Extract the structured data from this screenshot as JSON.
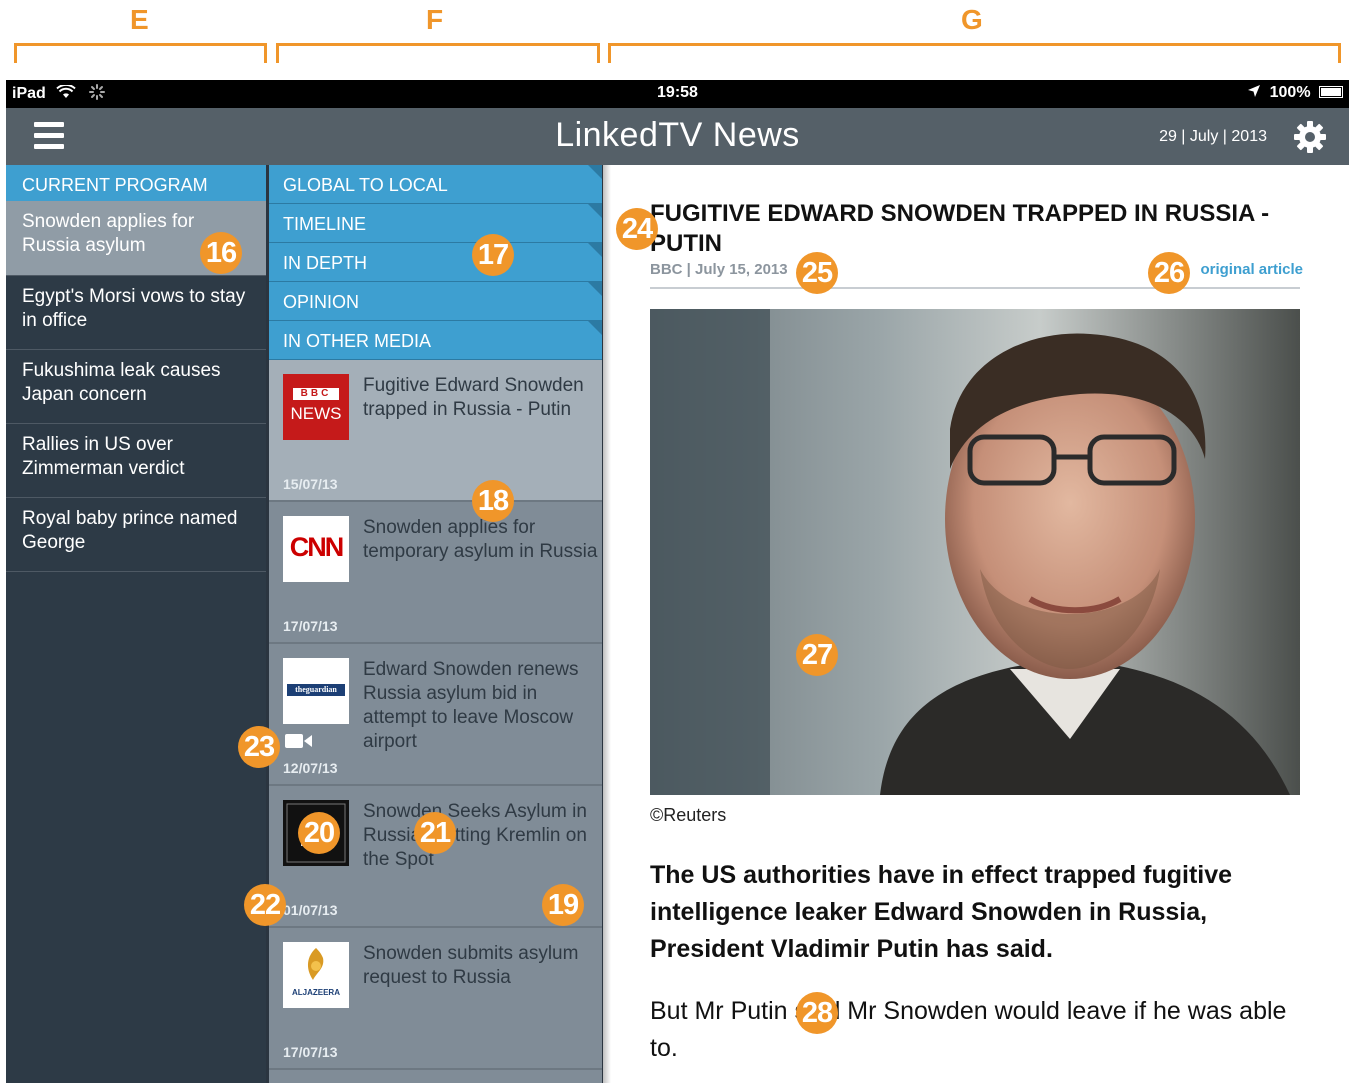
{
  "sections": [
    {
      "letter": "E"
    },
    {
      "letter": "F"
    },
    {
      "letter": "G"
    }
  ],
  "status_bar": {
    "device": "iPad",
    "time": "19:58",
    "battery": "100%"
  },
  "app_bar": {
    "title": "LinkedTV News",
    "date": "29 | July | 2013"
  },
  "program_list": {
    "header": "CURRENT PROGRAM",
    "items": [
      {
        "label": "Snowden applies for Russia asylum",
        "active": true
      },
      {
        "label": "Egypt's Morsi vows to stay in office",
        "active": false
      },
      {
        "label": "Fukushima leak causes Japan concern",
        "active": false
      },
      {
        "label": "Rallies in US over Zimmerman verdict",
        "active": false
      },
      {
        "label": "Royal baby prince named George",
        "active": false
      }
    ]
  },
  "topic_tabs": [
    "GLOBAL TO LOCAL",
    "TIMELINE",
    "IN DEPTH",
    "OPINION",
    "IN OTHER MEDIA"
  ],
  "media_items": [
    {
      "source_logo": "bbc-news-logo",
      "logo_text_1": "BBC",
      "logo_text_2": "NEWS",
      "title": "Fugitive Edward Snowden trapped in Russia - Putin",
      "date": "15/07/13"
    },
    {
      "source_logo": "cnn-logo",
      "logo_text_1": "CNN",
      "title": "Snowden applies for temporary asylum in Russia",
      "date": "17/07/13"
    },
    {
      "source_logo": "guardian-logo",
      "logo_text_1": "theguardian",
      "title": "Edward Snowden renews Russia asylum bid in attempt to leave Moscow airport",
      "date": "12/07/13"
    },
    {
      "source_logo": "nytimes-logo",
      "title": "Snowden Seeks Asylum in Russia, Putting Kremlin on the Spot",
      "date": "01/07/13"
    },
    {
      "source_logo": "aljazeera-logo",
      "logo_text_1": "ALJAZEERA",
      "title": "Snowden submits asylum request to Russia",
      "date": "17/07/13"
    }
  ],
  "article": {
    "title": "FUGITIVE EDWARD SNOWDEN TRAPPED IN RUSSIA - PUTIN",
    "meta": "BBC | July 15, 2013",
    "original_link": "original article",
    "photo_credit": "©Reuters",
    "lead": "The US authorities have in effect trapped fugitive intelligence leaker Edward Snowden in Russia, President Vladimir Putin has said.",
    "body": "But Mr Putin said Mr Snowden would leave if he was able to."
  },
  "markers": [
    "16",
    "17",
    "18",
    "19",
    "20",
    "21",
    "22",
    "23",
    "24",
    "25",
    "26",
    "27",
    "28"
  ],
  "colors": {
    "accent": "#3e9fd0",
    "marker": "#f0962a",
    "sidebar": "#2d3a46",
    "appbar": "#556068"
  }
}
